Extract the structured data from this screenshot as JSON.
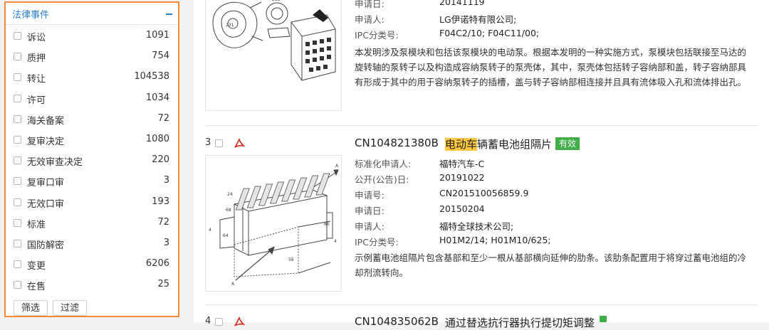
{
  "filter_panel": {
    "title": "法律事件",
    "items": [
      {
        "label": "诉讼",
        "count": "1091"
      },
      {
        "label": "质押",
        "count": "754"
      },
      {
        "label": "转让",
        "count": "104538"
      },
      {
        "label": "许可",
        "count": "1034"
      },
      {
        "label": "海关备案",
        "count": "72"
      },
      {
        "label": "复审决定",
        "count": "1080"
      },
      {
        "label": "无效审查决定",
        "count": "220"
      },
      {
        "label": "复审口审",
        "count": "3"
      },
      {
        "label": "无效口审",
        "count": "193"
      },
      {
        "label": "标准",
        "count": "72"
      },
      {
        "label": "国防解密",
        "count": "3"
      },
      {
        "label": "变更",
        "count": "6206"
      },
      {
        "label": "在售",
        "count": "25"
      }
    ],
    "buttons": {
      "filter": "筛选",
      "exclude": "过滤"
    }
  },
  "result_top": {
    "meta": [
      {
        "label": "申请日:",
        "value": "20141119"
      },
      {
        "label": "申请人:",
        "value": "LG伊诺特有限公司;"
      },
      {
        "label": "IPC分类号:",
        "value": "F04C2/10; F04C11/00;"
      }
    ],
    "abstract": "本发明涉及泵模块和包括该泵模块的电动泵。根据本发明的一种实施方式，泵模块包括联接至马达的旋转轴的泵转子以及构造成容纳泵转子的泵壳体，其中，泵壳体包括转子容纳部和盖，转子容纳部具有形成于其中的用于容纳泵转子的插槽，盖与转子容纳部相连接并且具有流体吸入孔和流体排出孔。",
    "drawing_labels": [
      "211",
      "231"
    ]
  },
  "result_3": {
    "rank": "3",
    "patent_no": "CN104821380B",
    "title_highlight": "电动车",
    "title_rest": "辆蓄电池组隔片",
    "status": "有效",
    "meta": [
      {
        "label": "标准化申请人:",
        "value": "福特汽车-C"
      },
      {
        "label": "公开(公告)日:",
        "value": "20191022"
      },
      {
        "label": "申请号:",
        "value": "CN201510056859.9"
      },
      {
        "label": "申请日:",
        "value": "20150204"
      },
      {
        "label": "申请人:",
        "value": "福特全球技术公司;"
      },
      {
        "label": "IPC分类号:",
        "value": "H01M2/14; H01M10/625;"
      }
    ],
    "abstract": "示例蓄电池组隔片包含基部和至少一根从基部横向延伸的肋条。该肋条配置用于将穿过蓄电池组的冷却剂流转向。",
    "drawing_labels": [
      "24",
      "68",
      "64",
      "60",
      "56",
      "4",
      "4",
      "A",
      "A"
    ]
  },
  "result_4": {
    "rank": "4",
    "patent_no": "CN104835062B",
    "title_rest": "通过替选抗行器执行提切矩调整"
  },
  "colors": {
    "accent": "#f08a3c",
    "link": "#2a7fc8",
    "valid": "#3fae49",
    "highlight": "#ffc740"
  }
}
